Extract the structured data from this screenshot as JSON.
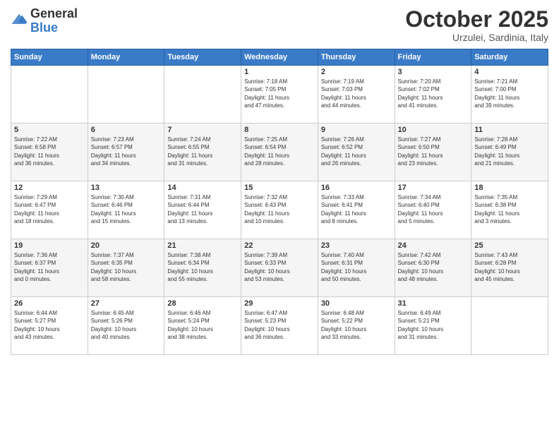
{
  "logo": {
    "general": "General",
    "blue": "Blue"
  },
  "header": {
    "month": "October 2025",
    "location": "Urzulei, Sardinia, Italy"
  },
  "weekdays": [
    "Sunday",
    "Monday",
    "Tuesday",
    "Wednesday",
    "Thursday",
    "Friday",
    "Saturday"
  ],
  "weeks": [
    [
      {
        "day": "",
        "info": ""
      },
      {
        "day": "",
        "info": ""
      },
      {
        "day": "",
        "info": ""
      },
      {
        "day": "1",
        "info": "Sunrise: 7:18 AM\nSunset: 7:05 PM\nDaylight: 11 hours\nand 47 minutes."
      },
      {
        "day": "2",
        "info": "Sunrise: 7:19 AM\nSunset: 7:03 PM\nDaylight: 11 hours\nand 44 minutes."
      },
      {
        "day": "3",
        "info": "Sunrise: 7:20 AM\nSunset: 7:02 PM\nDaylight: 11 hours\nand 41 minutes."
      },
      {
        "day": "4",
        "info": "Sunrise: 7:21 AM\nSunset: 7:00 PM\nDaylight: 11 hours\nand 39 minutes."
      }
    ],
    [
      {
        "day": "5",
        "info": "Sunrise: 7:22 AM\nSunset: 6:58 PM\nDaylight: 11 hours\nand 36 minutes."
      },
      {
        "day": "6",
        "info": "Sunrise: 7:23 AM\nSunset: 6:57 PM\nDaylight: 11 hours\nand 34 minutes."
      },
      {
        "day": "7",
        "info": "Sunrise: 7:24 AM\nSunset: 6:55 PM\nDaylight: 11 hours\nand 31 minutes."
      },
      {
        "day": "8",
        "info": "Sunrise: 7:25 AM\nSunset: 6:54 PM\nDaylight: 11 hours\nand 28 minutes."
      },
      {
        "day": "9",
        "info": "Sunrise: 7:26 AM\nSunset: 6:52 PM\nDaylight: 11 hours\nand 26 minutes."
      },
      {
        "day": "10",
        "info": "Sunrise: 7:27 AM\nSunset: 6:50 PM\nDaylight: 11 hours\nand 23 minutes."
      },
      {
        "day": "11",
        "info": "Sunrise: 7:28 AM\nSunset: 6:49 PM\nDaylight: 11 hours\nand 21 minutes."
      }
    ],
    [
      {
        "day": "12",
        "info": "Sunrise: 7:29 AM\nSunset: 6:47 PM\nDaylight: 11 hours\nand 18 minutes."
      },
      {
        "day": "13",
        "info": "Sunrise: 7:30 AM\nSunset: 6:46 PM\nDaylight: 11 hours\nand 15 minutes."
      },
      {
        "day": "14",
        "info": "Sunrise: 7:31 AM\nSunset: 6:44 PM\nDaylight: 11 hours\nand 13 minutes."
      },
      {
        "day": "15",
        "info": "Sunrise: 7:32 AM\nSunset: 6:43 PM\nDaylight: 11 hours\nand 10 minutes."
      },
      {
        "day": "16",
        "info": "Sunrise: 7:33 AM\nSunset: 6:41 PM\nDaylight: 11 hours\nand 8 minutes."
      },
      {
        "day": "17",
        "info": "Sunrise: 7:34 AM\nSunset: 6:40 PM\nDaylight: 11 hours\nand 5 minutes."
      },
      {
        "day": "18",
        "info": "Sunrise: 7:35 AM\nSunset: 6:38 PM\nDaylight: 11 hours\nand 3 minutes."
      }
    ],
    [
      {
        "day": "19",
        "info": "Sunrise: 7:36 AM\nSunset: 6:37 PM\nDaylight: 11 hours\nand 0 minutes."
      },
      {
        "day": "20",
        "info": "Sunrise: 7:37 AM\nSunset: 6:35 PM\nDaylight: 10 hours\nand 58 minutes."
      },
      {
        "day": "21",
        "info": "Sunrise: 7:38 AM\nSunset: 6:34 PM\nDaylight: 10 hours\nand 55 minutes."
      },
      {
        "day": "22",
        "info": "Sunrise: 7:39 AM\nSunset: 6:33 PM\nDaylight: 10 hours\nand 53 minutes."
      },
      {
        "day": "23",
        "info": "Sunrise: 7:40 AM\nSunset: 6:31 PM\nDaylight: 10 hours\nand 50 minutes."
      },
      {
        "day": "24",
        "info": "Sunrise: 7:42 AM\nSunset: 6:30 PM\nDaylight: 10 hours\nand 48 minutes."
      },
      {
        "day": "25",
        "info": "Sunrise: 7:43 AM\nSunset: 6:28 PM\nDaylight: 10 hours\nand 45 minutes."
      }
    ],
    [
      {
        "day": "26",
        "info": "Sunrise: 6:44 AM\nSunset: 5:27 PM\nDaylight: 10 hours\nand 43 minutes."
      },
      {
        "day": "27",
        "info": "Sunrise: 6:45 AM\nSunset: 5:26 PM\nDaylight: 10 hours\nand 40 minutes."
      },
      {
        "day": "28",
        "info": "Sunrise: 6:46 AM\nSunset: 5:24 PM\nDaylight: 10 hours\nand 38 minutes."
      },
      {
        "day": "29",
        "info": "Sunrise: 6:47 AM\nSunset: 5:23 PM\nDaylight: 10 hours\nand 36 minutes."
      },
      {
        "day": "30",
        "info": "Sunrise: 6:48 AM\nSunset: 5:22 PM\nDaylight: 10 hours\nand 33 minutes."
      },
      {
        "day": "31",
        "info": "Sunrise: 6:49 AM\nSunset: 5:21 PM\nDaylight: 10 hours\nand 31 minutes."
      },
      {
        "day": "",
        "info": ""
      }
    ]
  ]
}
